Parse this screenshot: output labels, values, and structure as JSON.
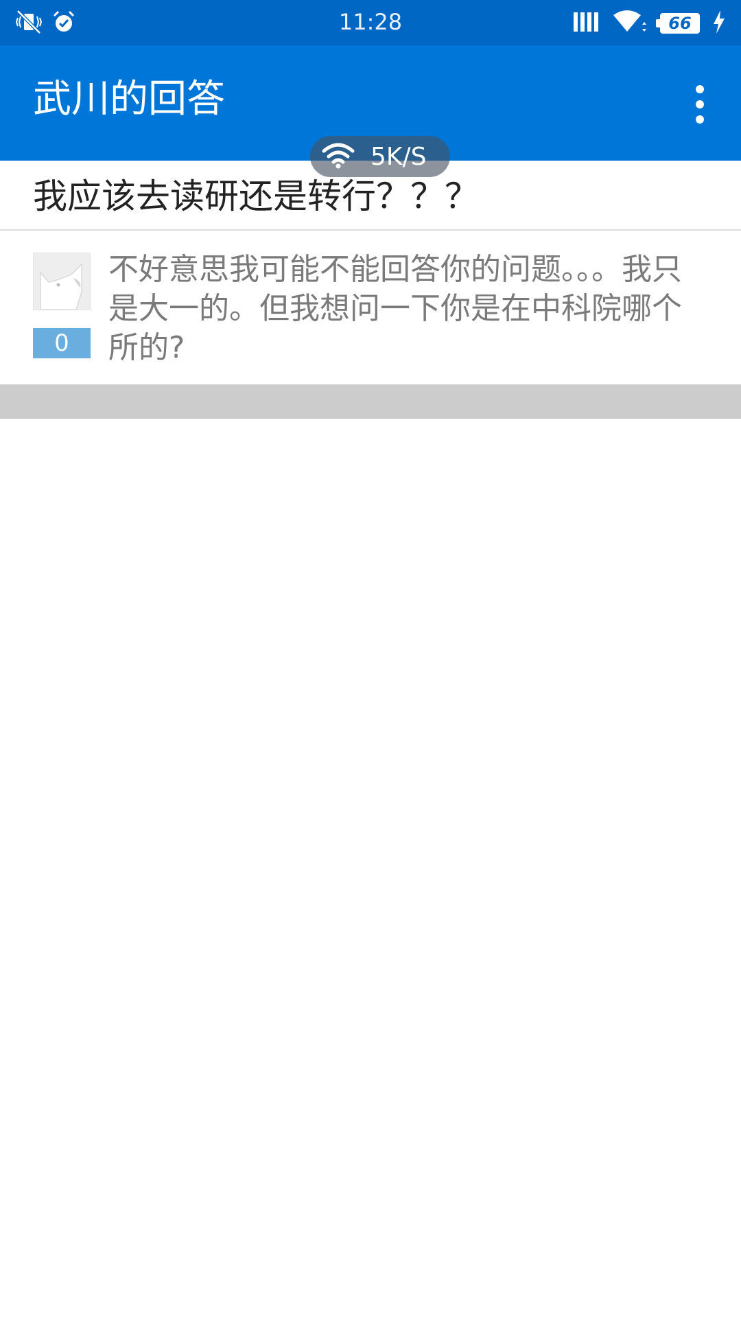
{
  "status_bar": {
    "time": "11:28",
    "battery_level": "66",
    "icons": [
      "vibrate-off-icon",
      "alarm-icon",
      "signal-icon",
      "wifi-icon",
      "battery-icon",
      "charging-icon"
    ]
  },
  "app_bar": {
    "title": "武川的回答",
    "menu_icon": "more-vert-icon"
  },
  "net_speed": {
    "value": "5K/S",
    "icon": "wifi-icon"
  },
  "question": {
    "title": "我应该去读研还是转行？？？"
  },
  "answer": {
    "vote_count": "0",
    "text": "不好意思我可能不能回答你的问题。。。我只是大一的。但我想问一下你是在中科院哪个所的?"
  },
  "colors": {
    "status_bar": "#0068c4",
    "app_bar": "#0077d8",
    "vote_badge": "#6aaee0",
    "footer_bar": "#cccccc"
  }
}
